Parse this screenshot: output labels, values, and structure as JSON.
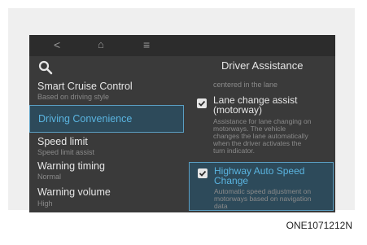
{
  "nav": {
    "back": "<",
    "home": "⌂",
    "menu": "≡"
  },
  "left_menu": {
    "items": [
      {
        "title": "Smart Cruise Control",
        "subtitle": "Based on driving style"
      },
      {
        "title": "Driving Convenience",
        "subtitle": ""
      },
      {
        "title": "Speed limit",
        "subtitle": "Speed limit assist"
      },
      {
        "title": "Warning timing",
        "subtitle": "Normal"
      },
      {
        "title": "Warning volume",
        "subtitle": "High"
      }
    ]
  },
  "right_panel": {
    "title": "Driver Assistance",
    "faded_text": "centered in the lane",
    "options": [
      {
        "title_line1": "Lane change assist",
        "title_line2": "(motorway)",
        "desc_line1": "Assistance for lane changing on",
        "desc_line2": "motorways. The vehicle",
        "desc_line3": "changes the lane automatically",
        "desc_line4": "when the driver activates the",
        "desc_line5": "turn indicator.",
        "checked": true
      },
      {
        "title_line1": "Highway Auto Speed",
        "title_line2": "Change",
        "desc_line1": "Automatic speed adjustment on",
        "desc_line2": "motorways based on navigation",
        "desc_line3": "data",
        "checked": true
      }
    ]
  },
  "caption": "ONE1071212N",
  "colors": {
    "screen_bg": "#3a3a3a",
    "accent": "#5ab4e0",
    "highlight_bg": "#2d4a5a"
  }
}
